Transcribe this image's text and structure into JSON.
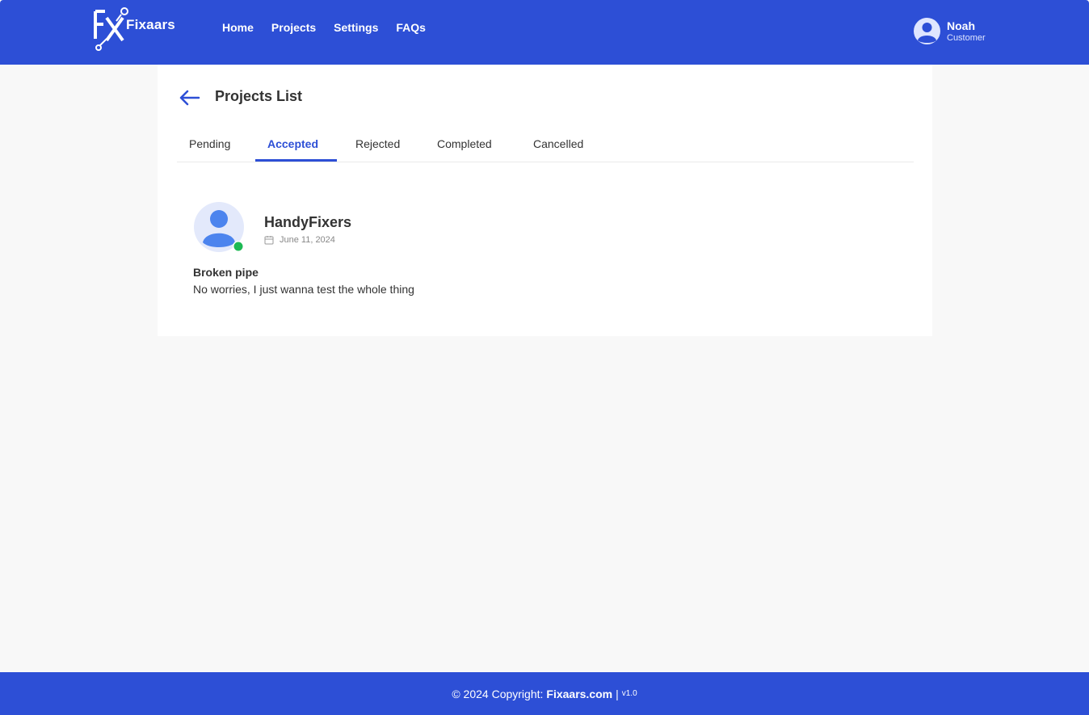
{
  "brand": {
    "name": "Fixaars"
  },
  "nav": {
    "items": [
      {
        "label": "Home"
      },
      {
        "label": "Projects"
      },
      {
        "label": "Settings"
      },
      {
        "label": "FAQs"
      }
    ]
  },
  "user": {
    "name": "Noah",
    "role": "Customer",
    "icon": "user-avatar-icon"
  },
  "page": {
    "title": "Projects List",
    "back_icon": "arrow-left-icon",
    "tabs": [
      {
        "label": "Pending"
      },
      {
        "label": "Accepted"
      },
      {
        "label": "Rejected"
      },
      {
        "label": "Completed"
      },
      {
        "label": "Cancelled"
      }
    ],
    "active_tab": "Accepted"
  },
  "project": {
    "company": "HandyFixers",
    "date": "June 11, 2024",
    "status_color": "#1db954",
    "title": "Broken pipe",
    "description": "No worries, I just wanna test the whole thing"
  },
  "footer": {
    "copyright_prefix": "© 2024 Copyright:",
    "site": "Fixaars.com",
    "separator": "|",
    "version": "v1.0"
  },
  "colors": {
    "primary": "#2d4fd6",
    "background": "#f8f8f8",
    "panel": "#ffffff"
  }
}
